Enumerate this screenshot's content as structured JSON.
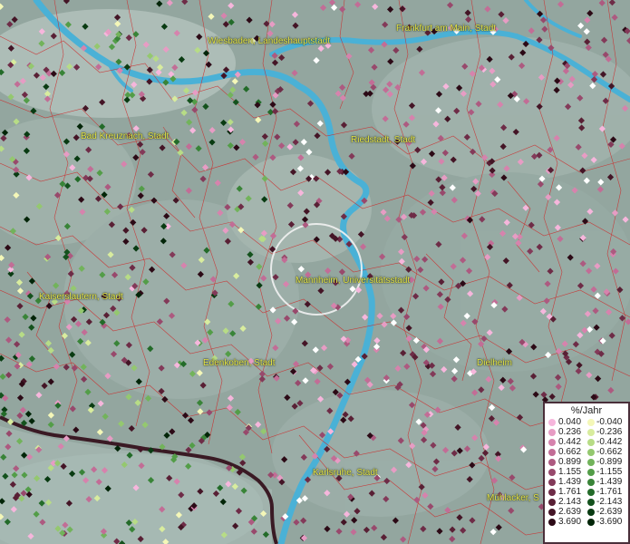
{
  "map": {
    "cities": [
      {
        "name": "Wiesbaden, Landeshauptstadt"
      },
      {
        "name": "Frankfurt am Main, Stadt"
      },
      {
        "name": "Bad Kreuznach, Stadt"
      },
      {
        "name": "Riedstadt, Stadt"
      },
      {
        "name": "Mannheim, Universitätsstadt"
      },
      {
        "name": "Kaiserslautern, Stadt"
      },
      {
        "name": "Edenkoben, Stadt"
      },
      {
        "name": "Dielheim"
      },
      {
        "name": "Karlsruhe, Stadt"
      },
      {
        "name": "Mühlacker, S"
      }
    ]
  },
  "legend": {
    "title": "%/Jahr",
    "positive": [
      {
        "label": "0.040",
        "color": "#f6b6dc"
      },
      {
        "label": "0.236",
        "color": "#e79cc4"
      },
      {
        "label": "0.442",
        "color": "#d683ad"
      },
      {
        "label": "0.662",
        "color": "#c26d96"
      },
      {
        "label": "0.899",
        "color": "#ad5a80"
      },
      {
        "label": "1.155",
        "color": "#98496c"
      },
      {
        "label": "1.439",
        "color": "#833a59"
      },
      {
        "label": "1.761",
        "color": "#6e2c47"
      },
      {
        "label": "2.143",
        "color": "#592035"
      },
      {
        "label": "2.639",
        "color": "#441526"
      },
      {
        "label": "3.690",
        "color": "#2c0a16"
      }
    ],
    "negative": [
      {
        "label": "-0.040",
        "color": "#f4f7b8"
      },
      {
        "label": "-0.236",
        "color": "#d8ec9e"
      },
      {
        "label": "-0.442",
        "color": "#b7dc86"
      },
      {
        "label": "-0.662",
        "color": "#94c86f"
      },
      {
        "label": "-0.899",
        "color": "#72b35b"
      },
      {
        "label": "-1.155",
        "color": "#539d48"
      },
      {
        "label": "-1.439",
        "color": "#398438"
      },
      {
        "label": "-1.761",
        "color": "#236b29"
      },
      {
        "label": "-2.143",
        "color": "#14521d"
      },
      {
        "label": "-2.639",
        "color": "#093b12"
      },
      {
        "label": "-3.690",
        "color": "#022508"
      }
    ]
  }
}
